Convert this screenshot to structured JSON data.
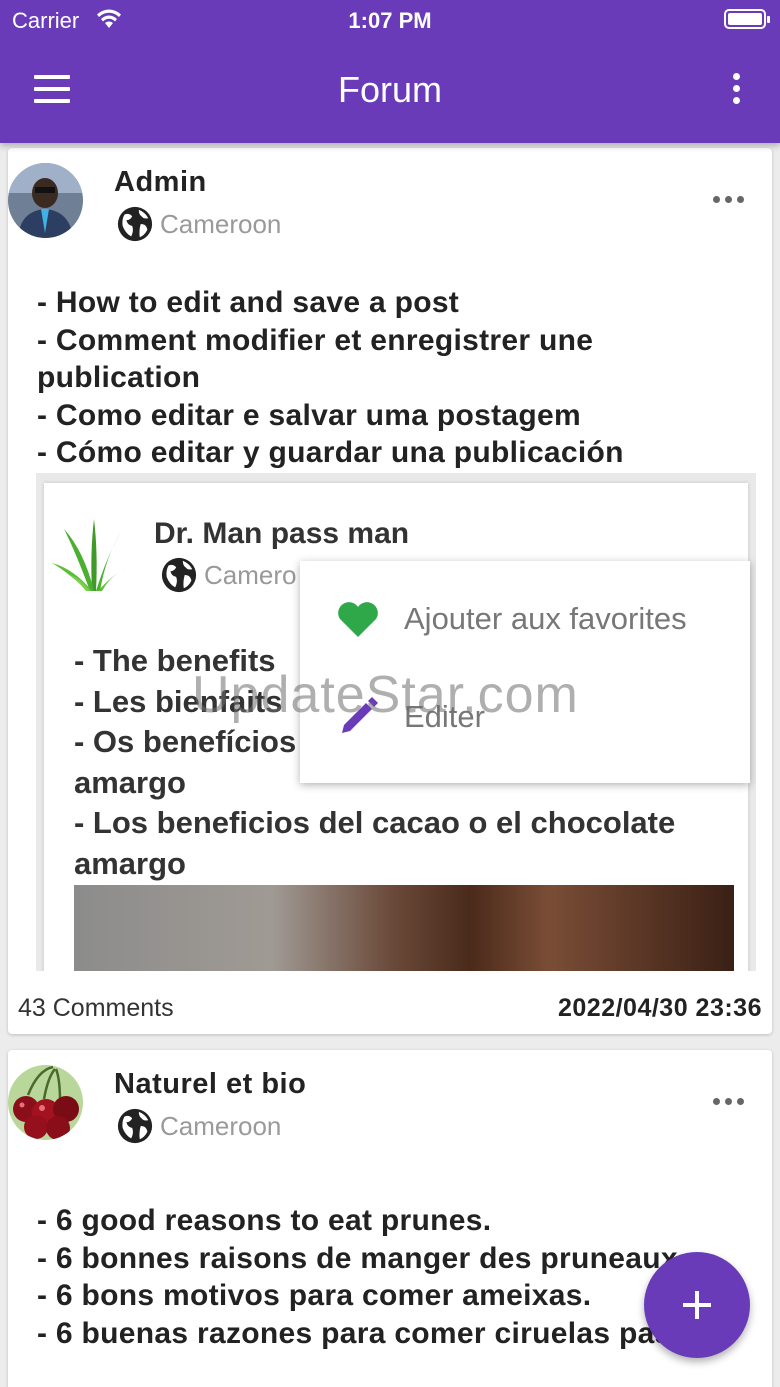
{
  "status_bar": {
    "carrier": "Carrier",
    "time": "1:07 PM"
  },
  "app_bar": {
    "title": "Forum",
    "menu_icon": "hamburger-menu-icon",
    "more_icon": "more-vertical-icon",
    "color": "#6a3bb9"
  },
  "posts": [
    {
      "author": "Admin",
      "location": "Cameroon",
      "lines": [
        "- How to edit and save a post",
        "- Comment modifier et enregistrer une publication",
        "- Como editar e salvar uma postagem",
        "- Cómo editar y guardar una publicación"
      ],
      "embedded_image": {
        "author": "Dr. Man pass man",
        "location": "Camero",
        "lines": [
          "- The benefits",
          "- Les bienfaits",
          "- Os benefícios",
          "amargo",
          "- Los beneficios del cacao o el chocolate amargo"
        ],
        "menu": {
          "favorite": "Ajouter aux favorites",
          "edit": "Editer"
        },
        "watermark": "UpdateStar.com"
      },
      "comments": "43 Comments",
      "date": "2022/04/30 23:36"
    },
    {
      "author": "Naturel et bio",
      "location": "Cameroon",
      "lines": [
        "- 6 good reasons to eat prunes.",
        "- 6 bonnes raisons de manger des pruneaux.",
        "- 6 bons motivos para comer ameixas.",
        "- 6 buenas razones para comer ciruelas pasas."
      ]
    }
  ],
  "fab": {
    "icon": "plus-icon"
  }
}
